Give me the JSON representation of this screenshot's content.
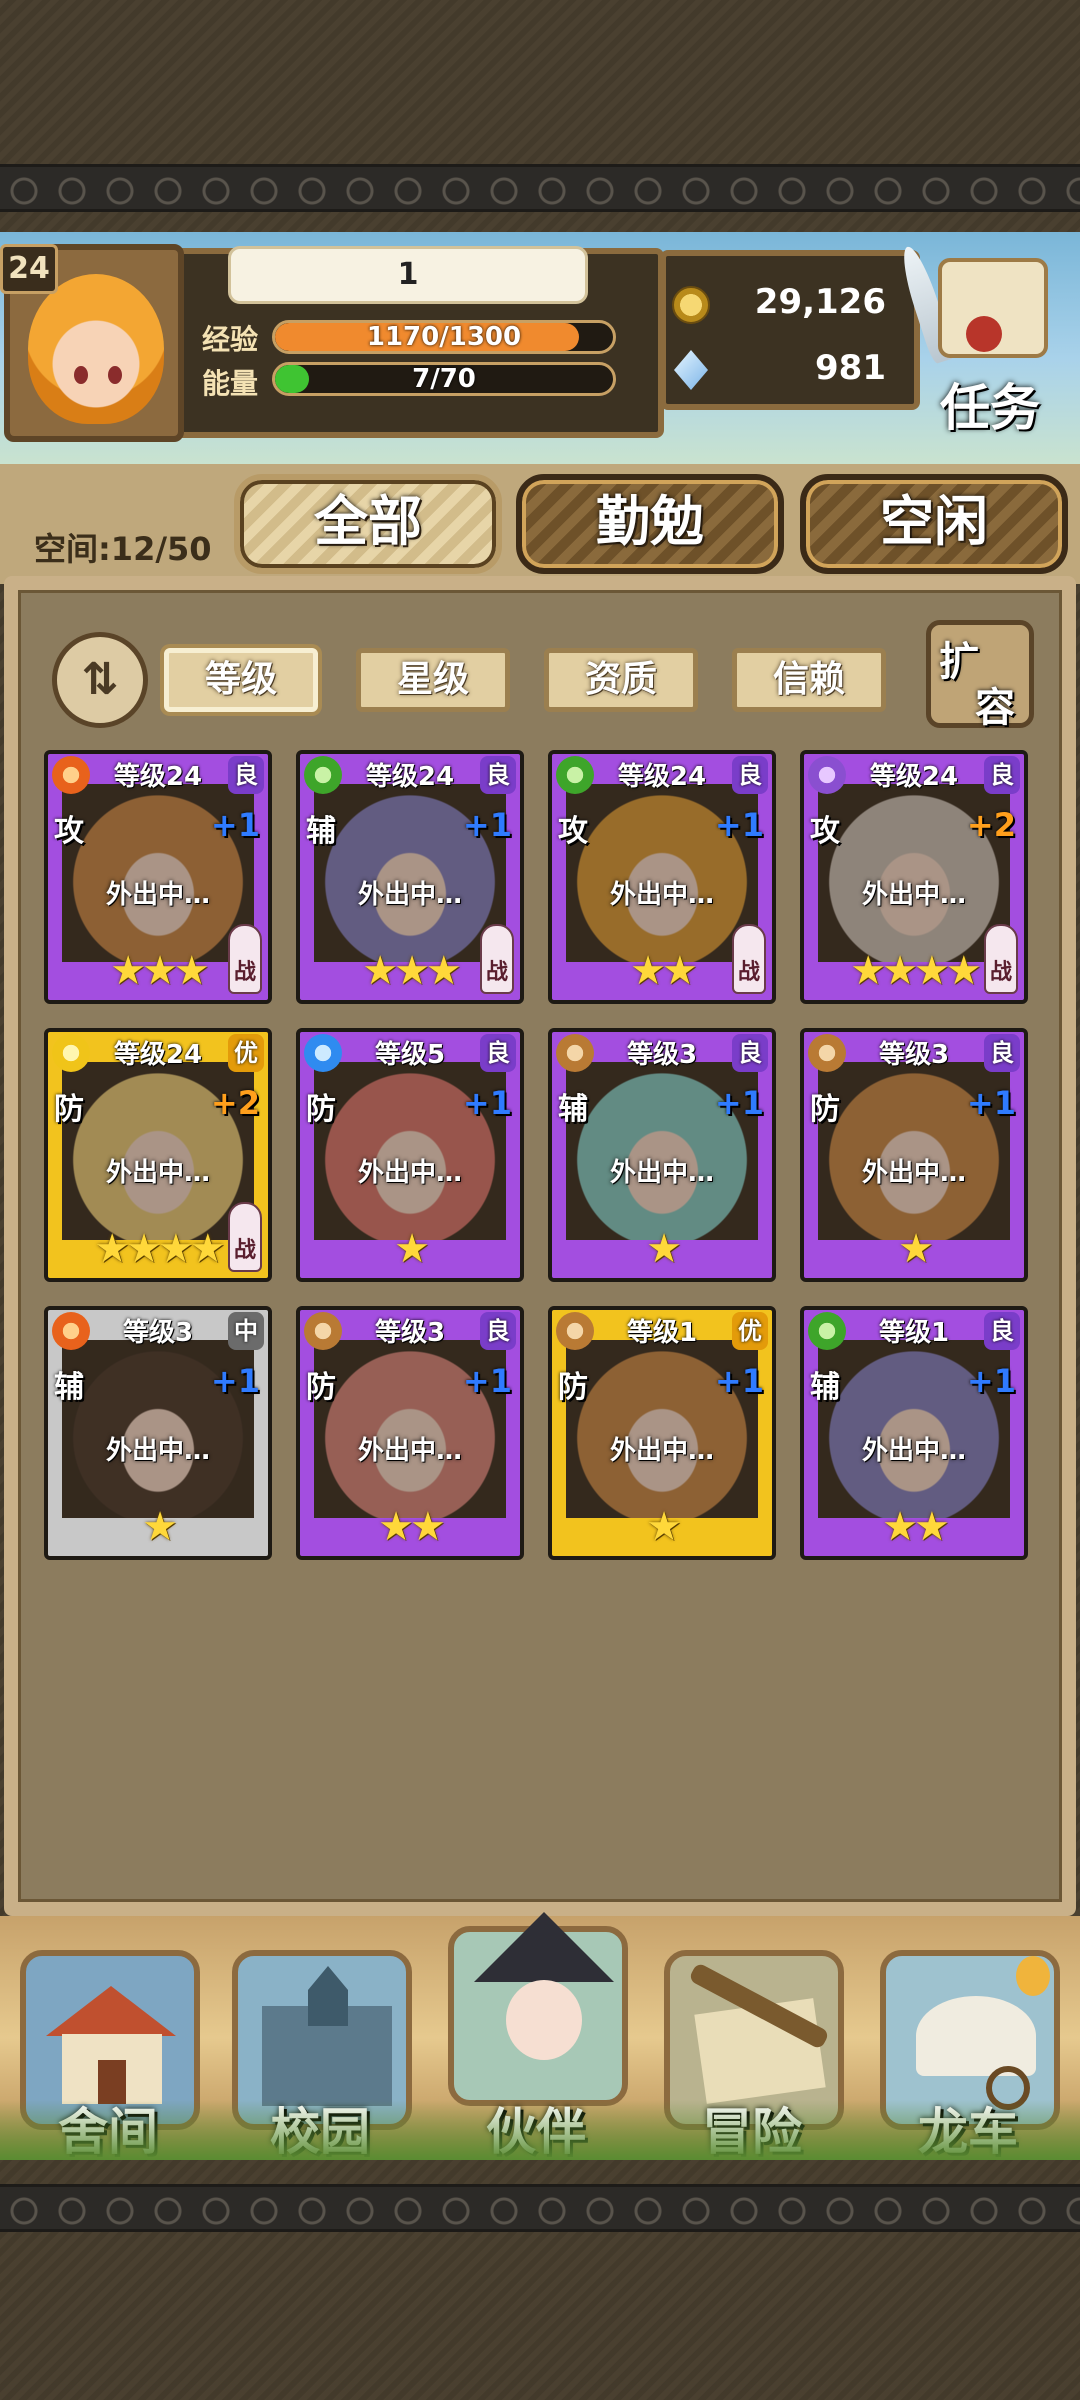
{
  "player": {
    "level": "24",
    "name": "1",
    "exp_label": "经验",
    "exp_text": "1170/1300",
    "exp_fraction": 0.9,
    "energy_label": "能量",
    "energy_text": "7/70",
    "energy_fraction": 0.1
  },
  "currency": {
    "gold": "29,126",
    "gems": "981"
  },
  "task": {
    "label": "任务"
  },
  "space": {
    "label": "空间:12/50"
  },
  "tabs": [
    {
      "label": "全部",
      "active": true
    },
    {
      "label": "勤勉",
      "active": false
    },
    {
      "label": "空闲",
      "active": false
    }
  ],
  "sort": {
    "icon": "sort-toggle-icon"
  },
  "filters": [
    {
      "label": "等级",
      "active": true
    },
    {
      "label": "星级",
      "active": false
    },
    {
      "label": "资质",
      "active": false
    },
    {
      "label": "信赖",
      "active": false
    }
  ],
  "expand": {
    "label_1": "扩",
    "label_2": "容"
  },
  "cards": [
    {
      "level": "等级24",
      "rarity": "良",
      "tier": "good",
      "element": "fire",
      "role": "攻",
      "plus": "+1",
      "plus_color": "#2f7bff",
      "status": "外出中…",
      "stars": "★★★",
      "battle": "战",
      "hair": "#c9894a"
    },
    {
      "level": "等级24",
      "rarity": "良",
      "tier": "good",
      "element": "leaf",
      "role": "辅",
      "plus": "+1",
      "plus_color": "#2f7bff",
      "status": "外出中…",
      "stars": "★★★",
      "battle": "战",
      "hair": "#8c83b8"
    },
    {
      "level": "等级24",
      "rarity": "良",
      "tier": "good",
      "element": "leaf",
      "role": "攻",
      "plus": "+1",
      "plus_color": "#2f7bff",
      "status": "外出中…",
      "stars": "★★",
      "battle": "战",
      "hair": "#d99a3c"
    },
    {
      "level": "等级24",
      "rarity": "良",
      "tier": "good",
      "element": "arcane",
      "role": "攻",
      "plus": "+2",
      "plus_color": "#ff9f1c",
      "status": "外出中…",
      "stars": "★★★★",
      "battle": "战",
      "hair": "#cbbcae"
    },
    {
      "level": "等级24",
      "rarity": "优",
      "tier": "great",
      "element": "light",
      "role": "防",
      "plus": "+2",
      "plus_color": "#ff9f1c",
      "status": "外出中…",
      "stars": "★★★★",
      "battle": "战",
      "hair": "#e7c778"
    },
    {
      "level": "等级5",
      "rarity": "良",
      "tier": "good",
      "element": "water",
      "role": "防",
      "plus": "+1",
      "plus_color": "#2f7bff",
      "status": "外出中…",
      "stars": "★",
      "battle": "",
      "hair": "#d97a6c"
    },
    {
      "level": "等级3",
      "rarity": "良",
      "tier": "good",
      "element": "earth",
      "role": "辅",
      "plus": "+1",
      "plus_color": "#2f7bff",
      "status": "外出中…",
      "stars": "★",
      "battle": "",
      "hair": "#8cc6bb"
    },
    {
      "level": "等级3",
      "rarity": "良",
      "tier": "good",
      "element": "earth",
      "role": "防",
      "plus": "+1",
      "plus_color": "#2f7bff",
      "status": "外出中…",
      "stars": "★",
      "battle": "",
      "hair": "#c98a4a"
    },
    {
      "level": "等级3",
      "rarity": "中",
      "tier": "mid",
      "element": "fire",
      "role": "辅",
      "plus": "+1",
      "plus_color": "#2f7bff",
      "status": "外出中…",
      "stars": "★",
      "battle": "",
      "hair": "#5a4434"
    },
    {
      "level": "等级3",
      "rarity": "良",
      "tier": "good",
      "element": "earth",
      "role": "防",
      "plus": "+1",
      "plus_color": "#2f7bff",
      "status": "外出中…",
      "stars": "★★",
      "battle": "",
      "hair": "#d7887a"
    },
    {
      "level": "等级1",
      "rarity": "优",
      "tier": "great",
      "element": "earth",
      "role": "防",
      "plus": "+1",
      "plus_color": "#2f7bff",
      "status": "外出中…",
      "stars": "★",
      "battle": "",
      "hair": "#c98a4a"
    },
    {
      "level": "等级1",
      "rarity": "良",
      "tier": "good",
      "element": "leaf",
      "role": "辅",
      "plus": "+1",
      "plus_color": "#2f7bff",
      "status": "外出中…",
      "stars": "★★",
      "battle": "",
      "hair": "#8c83b8"
    }
  ],
  "nav": [
    {
      "label": "舍间",
      "icon": "house-icon"
    },
    {
      "label": "校园",
      "icon": "school-icon"
    },
    {
      "label": "伙伴",
      "icon": "witch-girl-icon"
    },
    {
      "label": "冒险",
      "icon": "telescope-map-icon"
    },
    {
      "label": "龙车",
      "icon": "wagon-icon"
    }
  ],
  "colors": {
    "exp_bar": "#f08a2e",
    "energy_bar": "#3fc432",
    "rarity_good": "#7a3dc9",
    "rarity_great": "#e39b0a",
    "rarity_mid": "#6b6b6b"
  }
}
